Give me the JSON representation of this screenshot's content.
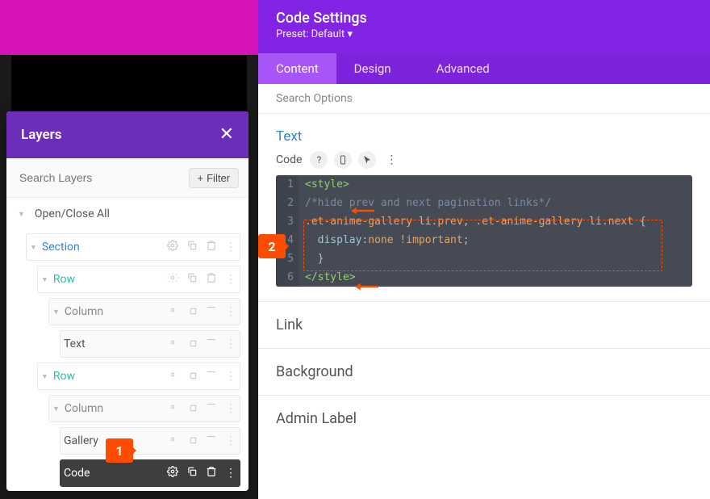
{
  "layers": {
    "title": "Layers",
    "search_placeholder": "Search Layers",
    "filter_label": "Filter",
    "open_close": "Open/Close All",
    "items": {
      "section": "Section",
      "row1": "Row",
      "col1": "Column",
      "text": "Text",
      "row2": "Row",
      "col2": "Column",
      "gallery": "Gallery",
      "code": "Code"
    }
  },
  "settings": {
    "title": "Code Settings",
    "preset": "Preset: Default",
    "tabs": {
      "content": "Content",
      "design": "Design",
      "advanced": "Advanced"
    },
    "search_options": "Search Options",
    "text_heading": "Text",
    "code_label": "Code",
    "code": {
      "l1": "<style>",
      "l2": "/*hide prev and next pagination links*/",
      "l3a": ".et-anime-gallery",
      "l3b": " li",
      "l3c": ".prev",
      "l3d": ", ",
      "l3e": ".et-anime-gallery",
      "l3f": " li",
      "l3g": ".next",
      "l3h": " {",
      "l4a": "  display",
      "l4b": ":",
      "l4c": "none",
      "l4d": " !important",
      "l4e": ";",
      "l5": "  }",
      "l6": "</style>"
    },
    "link_heading": "Link",
    "background_heading": "Background",
    "admin_label_heading": "Admin Label"
  },
  "markers": {
    "m1": "1",
    "m2": "2"
  }
}
